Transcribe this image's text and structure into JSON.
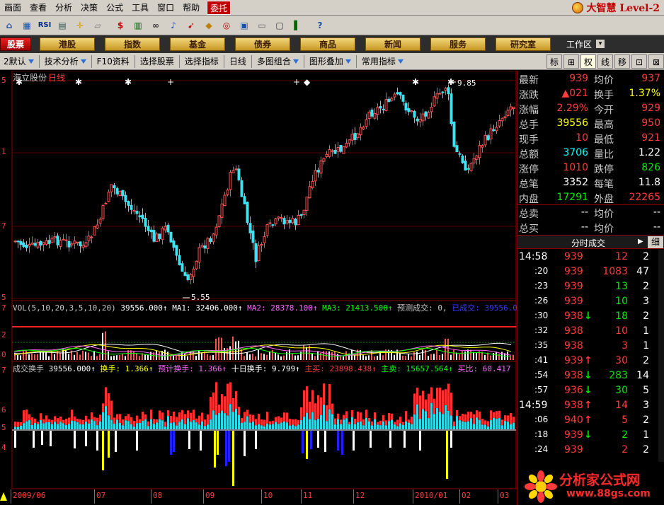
{
  "menu": [
    "画面",
    "查看",
    "分析",
    "决策",
    "公式",
    "工具",
    "窗口",
    "帮助"
  ],
  "menu_entrust": "委托",
  "brand": "大智慧 Level-2",
  "toolbar_icons": [
    {
      "name": "home-icon",
      "glyph": "⌂"
    },
    {
      "name": "grid-icon",
      "glyph": "▦"
    },
    {
      "name": "rsi-icon",
      "glyph": "RSI"
    },
    {
      "name": "table-icon",
      "glyph": "▤"
    },
    {
      "name": "crosshair-icon",
      "glyph": "✛"
    },
    {
      "name": "ruler-icon",
      "glyph": "▱"
    },
    {
      "name": "dollar-icon",
      "glyph": "$"
    },
    {
      "name": "bars-icon",
      "glyph": "▥"
    },
    {
      "name": "binoculars-icon",
      "glyph": "∞"
    },
    {
      "name": "bell-icon",
      "glyph": "♪"
    },
    {
      "name": "arrow-icon",
      "glyph": "➹"
    },
    {
      "name": "diamond-icon",
      "glyph": "◆"
    },
    {
      "name": "ring-icon",
      "glyph": "◎"
    },
    {
      "name": "book-icon",
      "glyph": "▣"
    },
    {
      "name": "note-icon",
      "glyph": "▭"
    },
    {
      "name": "window-icon",
      "glyph": "▢"
    },
    {
      "name": "chart-icon",
      "glyph": "▌"
    },
    {
      "name": "help-icon",
      "glyph": "?"
    }
  ],
  "modules": [
    "股票",
    "港股",
    "指数",
    "基金",
    "债券",
    "商品",
    "新闻",
    "服务",
    "研究室"
  ],
  "workarea": "工作区",
  "subbar": {
    "items": [
      "2默认",
      "技术分析",
      "F10资料",
      "选择股票",
      "选择指标",
      "日线",
      "多图组合",
      "图形叠加",
      "常用指标"
    ],
    "right_tabs": [
      "标",
      "⊞",
      "权",
      "线",
      "移",
      "⊡",
      "⊠"
    ]
  },
  "chart": {
    "stock_name": "海立股份",
    "period": "日线",
    "high_marker": "9.85",
    "low_marker": "5.55",
    "price_axis": [
      "5",
      "1",
      "7",
      "5"
    ],
    "vol_axis": [
      "7",
      "2",
      "0"
    ],
    "turn_axis": [
      "7",
      "6",
      "5",
      "4"
    ],
    "vol_title": "VOL(5,10,20,3,5,10,20)",
    "vol_value": "39556.000↑",
    "ma1": "MA1: 32406.000↑",
    "ma2": "MA2: 28378.100↑",
    "ma3": "MA3: 21413.500↑",
    "forecast": "预测成交: 0,",
    "traded": "已成交: 39556.00",
    "turn_label": "换",
    "turn_title": "成交换手",
    "turn_value": "39556.000↑",
    "turnover": "换手: 1.366↑",
    "forecast_turn": "预计换手: 1.366↑",
    "ten_day_turn": "十日换手: 9.799↑",
    "main_buy": "主买: 23898.438↑",
    "main_sell": "主卖: 15657.564↑",
    "buy_ratio": "买比: 60.417",
    "date_axis": [
      "2009/06",
      "07",
      "08",
      "09",
      "10",
      "11",
      "12",
      "2010/01",
      "02",
      "03"
    ]
  },
  "quote": {
    "rows": [
      {
        "l1": "最新",
        "v1": "939",
        "c1": "red",
        "l2": "均价",
        "v2": "937",
        "c2": "red"
      },
      {
        "l1": "涨跌",
        "v1": "▲021",
        "c1": "red",
        "l2": "换手",
        "v2": "1.37%",
        "c2": "yellow"
      },
      {
        "l1": "涨幅",
        "v1": "2.29%",
        "c1": "red",
        "l2": "今开",
        "v2": "929",
        "c2": "red"
      },
      {
        "l1": "总手",
        "v1": "39556",
        "c1": "yellow",
        "l2": "最高",
        "v2": "950",
        "c2": "red"
      },
      {
        "l1": "现手",
        "v1": "10",
        "c1": "red",
        "l2": "最低",
        "v2": "921",
        "c2": "red"
      },
      {
        "l1": "总额",
        "v1": "3706",
        "c1": "cyan",
        "l2": "量比",
        "v2": "1.22",
        "c2": "white"
      },
      {
        "l1": "涨停",
        "v1": "1010",
        "c1": "red",
        "l2": "跌停",
        "v2": "826",
        "c2": "green"
      },
      {
        "l1": "总笔",
        "v1": "3352",
        "c1": "white",
        "l2": "每笔",
        "v2": "11.8",
        "c2": "white"
      },
      {
        "l1": "内盘",
        "v1": "17291",
        "c1": "green",
        "l2": "外盘",
        "v2": "22265",
        "c2": "red"
      }
    ],
    "rows2": [
      {
        "l1": "总卖",
        "v1": "--",
        "l2": "均价",
        "v2": "--"
      },
      {
        "l1": "总买",
        "v1": "--",
        "l2": "均价",
        "v2": "--"
      }
    ],
    "ticks_title": "分时成交",
    "ticks_tab": "细",
    "ticks": [
      {
        "t": "14:58",
        "p": "939",
        "arrow": "",
        "pc": "red",
        "v": "12",
        "vc": "red",
        "n": "2"
      },
      {
        "t": ":20",
        "p": "939",
        "arrow": "",
        "pc": "red",
        "v": "1083",
        "vc": "red",
        "n": "47"
      },
      {
        "t": ":23",
        "p": "939",
        "arrow": "",
        "pc": "red",
        "v": "13",
        "vc": "green",
        "n": "2"
      },
      {
        "t": ":26",
        "p": "939",
        "arrow": "",
        "pc": "red",
        "v": "10",
        "vc": "green",
        "n": "3"
      },
      {
        "t": ":30",
        "p": "938",
        "arrow": "↓",
        "pc": "red",
        "v": "18",
        "vc": "green",
        "n": "2"
      },
      {
        "t": ":32",
        "p": "938",
        "arrow": "",
        "pc": "red",
        "v": "10",
        "vc": "red",
        "n": "1"
      },
      {
        "t": ":35",
        "p": "938",
        "arrow": "",
        "pc": "red",
        "v": "3",
        "vc": "red",
        "n": "1"
      },
      {
        "t": ":41",
        "p": "939",
        "arrow": "↑",
        "pc": "red",
        "v": "30",
        "vc": "red",
        "n": "2"
      },
      {
        "t": ":54",
        "p": "938",
        "arrow": "↓",
        "pc": "red",
        "v": "283",
        "vc": "green",
        "n": "14"
      },
      {
        "t": ":57",
        "p": "936",
        "arrow": "↓",
        "pc": "red",
        "v": "30",
        "vc": "green",
        "n": "5"
      },
      {
        "t": "14:59",
        "p": "938",
        "arrow": "↑",
        "pc": "red",
        "v": "14",
        "vc": "red",
        "n": "3"
      },
      {
        "t": ":06",
        "p": "940",
        "arrow": "↑",
        "pc": "red",
        "v": "5",
        "vc": "red",
        "n": "2"
      },
      {
        "t": ":18",
        "p": "939",
        "arrow": "↓",
        "pc": "red",
        "v": "2",
        "vc": "green",
        "n": "1"
      },
      {
        "t": ":24",
        "p": "939",
        "arrow": "",
        "pc": "red",
        "v": "2",
        "vc": "red",
        "n": "2"
      }
    ]
  },
  "watermark": {
    "title": "分析家公式网",
    "url": "www.88gs.com"
  }
}
